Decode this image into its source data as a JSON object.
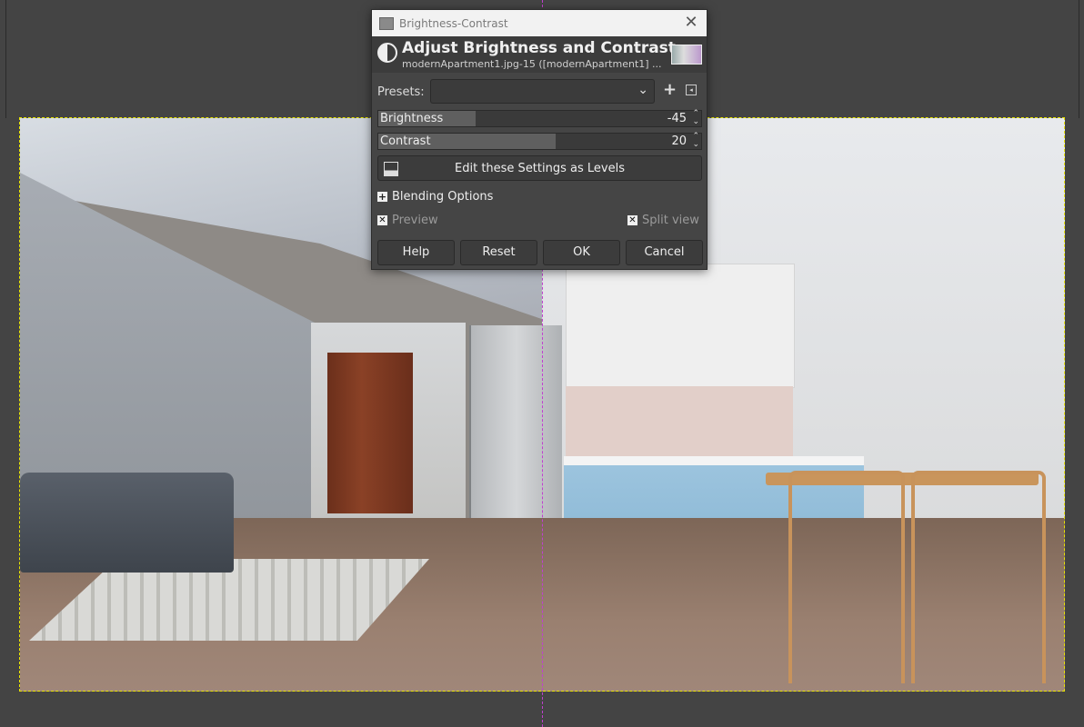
{
  "dialog": {
    "window_title": "Brightness-Contrast",
    "header_title": "Adjust Brightness and Contrast",
    "header_subtitle": "modernApartment1.jpg-15 ([modernApartment1] ...",
    "presets_label": "Presets:",
    "presets_value": "",
    "brightness": {
      "label": "Brightness",
      "value": "-45",
      "fill_fraction": 0.3
    },
    "contrast": {
      "label": "Contrast",
      "value": "20",
      "fill_fraction": 0.55
    },
    "levels_button": "Edit these Settings as Levels",
    "blending_options": "Blending Options",
    "preview": {
      "label": "Preview",
      "checked": true
    },
    "split_view": {
      "label": "Split view",
      "checked": true
    },
    "buttons": {
      "help": "Help",
      "reset": "Reset",
      "ok": "OK",
      "cancel": "Cancel"
    }
  },
  "icons": {
    "close": "close-icon",
    "contrast": "brightness-contrast-icon",
    "add_preset": "plus-icon",
    "preset_menu": "menu-icon",
    "levels": "levels-icon"
  },
  "colors": {
    "canvas_bg": "#454545",
    "dialog_bg": "#454545",
    "guide": "#c040d0",
    "selection": "#e8e400"
  }
}
